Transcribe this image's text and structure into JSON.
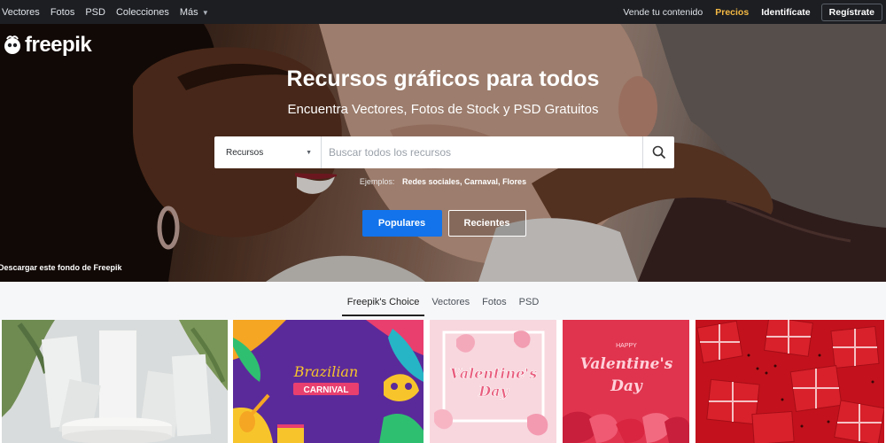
{
  "topnav": {
    "items": [
      "Vectores",
      "Fotos",
      "PSD",
      "Colecciones",
      "Más"
    ],
    "sell": "Vende tu contenido",
    "pricing": "Precios",
    "login": "Identifícate",
    "register": "Regístrate"
  },
  "logo": "freepik",
  "hero": {
    "title": "Recursos gráficos para todos",
    "subtitle": "Encuentra Vectores, Fotos de Stock y PSD Gratuitos",
    "search": {
      "select": "Recursos",
      "placeholder": "Buscar todos los recursos"
    },
    "examples_label": "Ejemplos:",
    "examples": [
      "Redes sociales",
      "Carnaval",
      "Flores"
    ],
    "btn_popular": "Populares",
    "btn_recent": "Recientes",
    "credit": "Descargar este fondo de Freepik"
  },
  "tabs": [
    "Freepik's Choice",
    "Vectores",
    "Fotos",
    "PSD"
  ],
  "cards": {
    "carnival_title": "Brazilian",
    "carnival_banner": "CARNIVAL",
    "card3_line1": "Valentine's",
    "card3_line2": "Day",
    "card4_happy": "HAPPY",
    "card4_line1": "Valentine's",
    "card4_line2": "Day"
  },
  "colors": {
    "accent": "#1273eb",
    "pricing": "#f5b944",
    "topbar": "#1c1e22"
  }
}
